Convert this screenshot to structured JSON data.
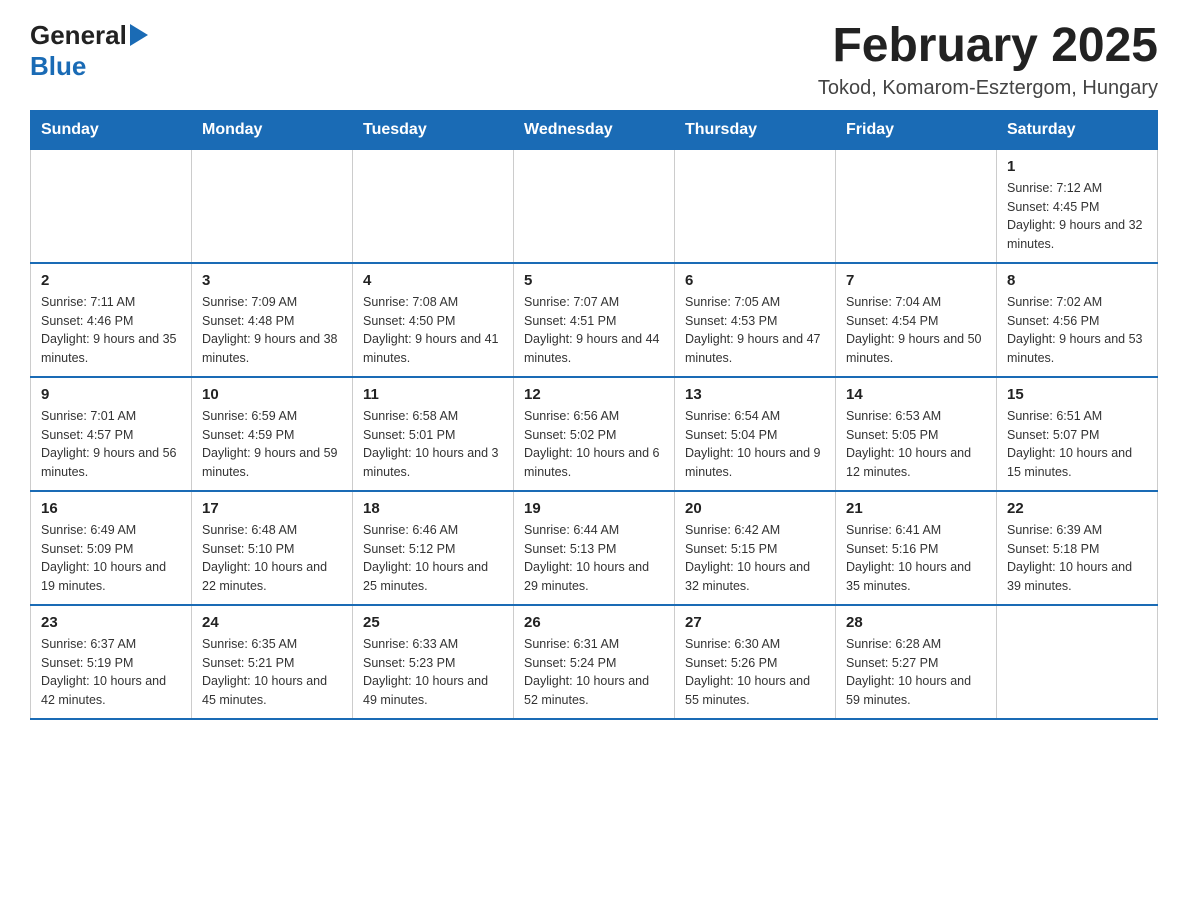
{
  "header": {
    "month_title": "February 2025",
    "location": "Tokod, Komarom-Esztergom, Hungary",
    "logo_general": "General",
    "logo_blue": "Blue"
  },
  "weekdays": [
    "Sunday",
    "Monday",
    "Tuesday",
    "Wednesday",
    "Thursday",
    "Friday",
    "Saturday"
  ],
  "weeks": [
    [
      {
        "day": "",
        "info": ""
      },
      {
        "day": "",
        "info": ""
      },
      {
        "day": "",
        "info": ""
      },
      {
        "day": "",
        "info": ""
      },
      {
        "day": "",
        "info": ""
      },
      {
        "day": "",
        "info": ""
      },
      {
        "day": "1",
        "info": "Sunrise: 7:12 AM\nSunset: 4:45 PM\nDaylight: 9 hours and 32 minutes."
      }
    ],
    [
      {
        "day": "2",
        "info": "Sunrise: 7:11 AM\nSunset: 4:46 PM\nDaylight: 9 hours and 35 minutes."
      },
      {
        "day": "3",
        "info": "Sunrise: 7:09 AM\nSunset: 4:48 PM\nDaylight: 9 hours and 38 minutes."
      },
      {
        "day": "4",
        "info": "Sunrise: 7:08 AM\nSunset: 4:50 PM\nDaylight: 9 hours and 41 minutes."
      },
      {
        "day": "5",
        "info": "Sunrise: 7:07 AM\nSunset: 4:51 PM\nDaylight: 9 hours and 44 minutes."
      },
      {
        "day": "6",
        "info": "Sunrise: 7:05 AM\nSunset: 4:53 PM\nDaylight: 9 hours and 47 minutes."
      },
      {
        "day": "7",
        "info": "Sunrise: 7:04 AM\nSunset: 4:54 PM\nDaylight: 9 hours and 50 minutes."
      },
      {
        "day": "8",
        "info": "Sunrise: 7:02 AM\nSunset: 4:56 PM\nDaylight: 9 hours and 53 minutes."
      }
    ],
    [
      {
        "day": "9",
        "info": "Sunrise: 7:01 AM\nSunset: 4:57 PM\nDaylight: 9 hours and 56 minutes."
      },
      {
        "day": "10",
        "info": "Sunrise: 6:59 AM\nSunset: 4:59 PM\nDaylight: 9 hours and 59 minutes."
      },
      {
        "day": "11",
        "info": "Sunrise: 6:58 AM\nSunset: 5:01 PM\nDaylight: 10 hours and 3 minutes."
      },
      {
        "day": "12",
        "info": "Sunrise: 6:56 AM\nSunset: 5:02 PM\nDaylight: 10 hours and 6 minutes."
      },
      {
        "day": "13",
        "info": "Sunrise: 6:54 AM\nSunset: 5:04 PM\nDaylight: 10 hours and 9 minutes."
      },
      {
        "day": "14",
        "info": "Sunrise: 6:53 AM\nSunset: 5:05 PM\nDaylight: 10 hours and 12 minutes."
      },
      {
        "day": "15",
        "info": "Sunrise: 6:51 AM\nSunset: 5:07 PM\nDaylight: 10 hours and 15 minutes."
      }
    ],
    [
      {
        "day": "16",
        "info": "Sunrise: 6:49 AM\nSunset: 5:09 PM\nDaylight: 10 hours and 19 minutes."
      },
      {
        "day": "17",
        "info": "Sunrise: 6:48 AM\nSunset: 5:10 PM\nDaylight: 10 hours and 22 minutes."
      },
      {
        "day": "18",
        "info": "Sunrise: 6:46 AM\nSunset: 5:12 PM\nDaylight: 10 hours and 25 minutes."
      },
      {
        "day": "19",
        "info": "Sunrise: 6:44 AM\nSunset: 5:13 PM\nDaylight: 10 hours and 29 minutes."
      },
      {
        "day": "20",
        "info": "Sunrise: 6:42 AM\nSunset: 5:15 PM\nDaylight: 10 hours and 32 minutes."
      },
      {
        "day": "21",
        "info": "Sunrise: 6:41 AM\nSunset: 5:16 PM\nDaylight: 10 hours and 35 minutes."
      },
      {
        "day": "22",
        "info": "Sunrise: 6:39 AM\nSunset: 5:18 PM\nDaylight: 10 hours and 39 minutes."
      }
    ],
    [
      {
        "day": "23",
        "info": "Sunrise: 6:37 AM\nSunset: 5:19 PM\nDaylight: 10 hours and 42 minutes."
      },
      {
        "day": "24",
        "info": "Sunrise: 6:35 AM\nSunset: 5:21 PM\nDaylight: 10 hours and 45 minutes."
      },
      {
        "day": "25",
        "info": "Sunrise: 6:33 AM\nSunset: 5:23 PM\nDaylight: 10 hours and 49 minutes."
      },
      {
        "day": "26",
        "info": "Sunrise: 6:31 AM\nSunset: 5:24 PM\nDaylight: 10 hours and 52 minutes."
      },
      {
        "day": "27",
        "info": "Sunrise: 6:30 AM\nSunset: 5:26 PM\nDaylight: 10 hours and 55 minutes."
      },
      {
        "day": "28",
        "info": "Sunrise: 6:28 AM\nSunset: 5:27 PM\nDaylight: 10 hours and 59 minutes."
      },
      {
        "day": "",
        "info": ""
      }
    ]
  ]
}
